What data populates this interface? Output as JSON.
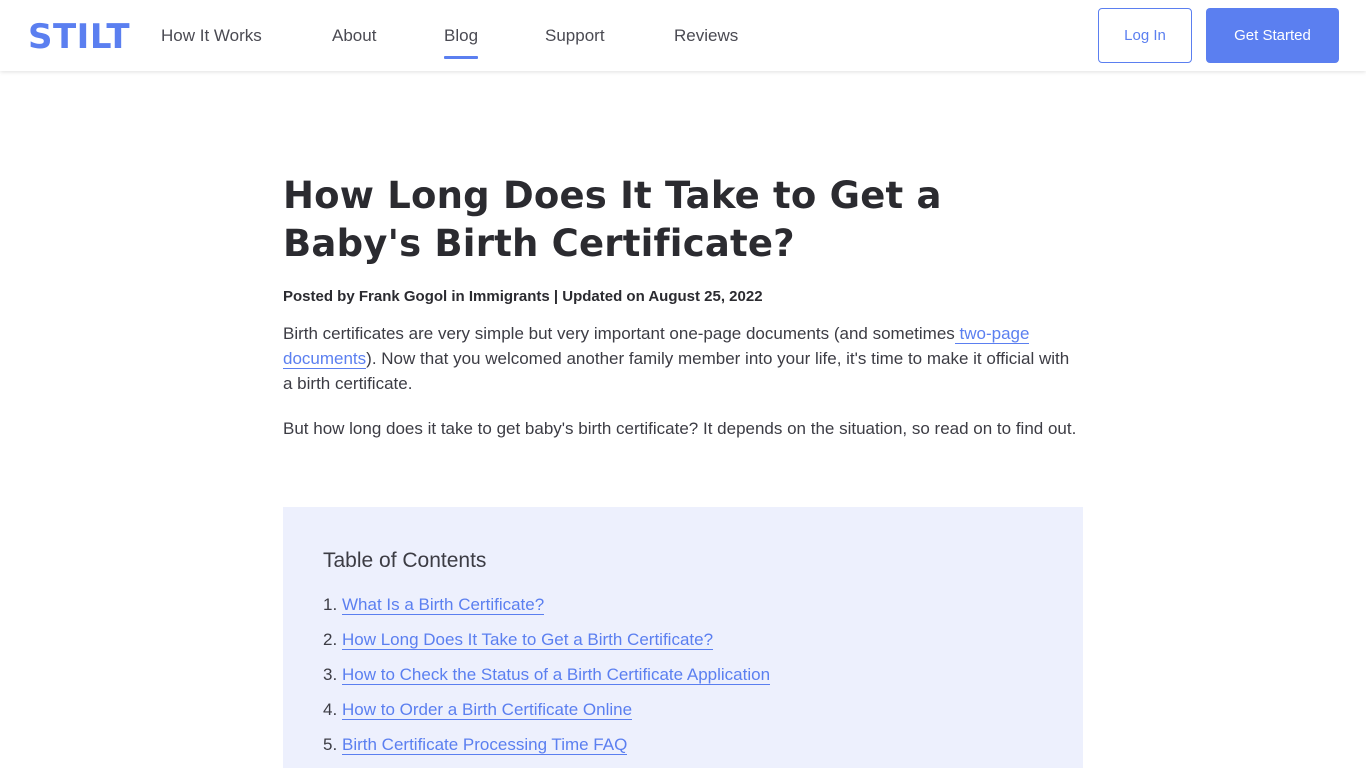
{
  "header": {
    "logo": "STILT",
    "nav": [
      {
        "label": "How It Works",
        "active": false
      },
      {
        "label": "About",
        "active": false
      },
      {
        "label": "Blog",
        "active": true
      },
      {
        "label": "Support",
        "active": false
      },
      {
        "label": "Reviews",
        "active": false
      }
    ],
    "login_label": "Log In",
    "get_started_label": "Get Started"
  },
  "article": {
    "title": "How Long Does It Take to Get a Baby's Birth Certificate?",
    "byline": "Posted by Frank Gogol in Immigrants | Updated on August 25, 2022",
    "para1_before": "Birth certificates are very simple but very important one-page documents (and sometimes",
    "para1_link": " two-page documents",
    "para1_after": "). Now that you welcomed another family member into your life, it's time to make it official with a birth certificate.",
    "para2": "But how long does it take to get baby's birth certificate? It depends on the situation, so read on to find out."
  },
  "toc": {
    "title": "Table of Contents",
    "items": [
      {
        "num": "1.",
        "label": "What Is a Birth Certificate?"
      },
      {
        "num": "2.",
        "label": "How Long Does It Take to Get a Birth Certificate?"
      },
      {
        "num": "3.",
        "label": "How to Check the Status of a Birth Certificate Application"
      },
      {
        "num": "4.",
        "label": "How to Order a Birth Certificate Online"
      },
      {
        "num": "5.",
        "label": "Birth Certificate Processing Time FAQ "
      }
    ]
  },
  "colors": {
    "accent": "#5b7ff0",
    "toc_background": "#edf0fd",
    "text": "#2b2b30"
  }
}
